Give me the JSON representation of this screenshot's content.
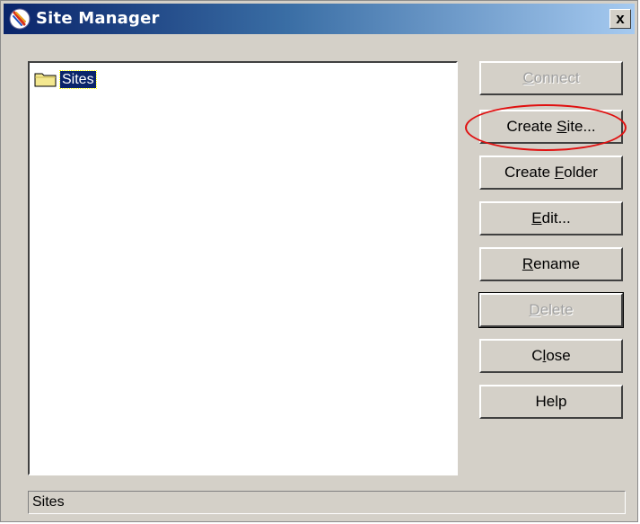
{
  "window": {
    "title": "Site Manager",
    "close_label": "x"
  },
  "tree": {
    "items": [
      {
        "label": "Sites",
        "icon": "folder-icon",
        "selected": true
      }
    ]
  },
  "buttons": [
    {
      "label": "Connect",
      "mnemonic": "C",
      "rest": "onnect",
      "disabled": true
    },
    {
      "label": "Create Site...",
      "prefix": "Create ",
      "mnemonic": "S",
      "rest": "ite...",
      "disabled": false,
      "highlighted": true
    },
    {
      "label": "Create Folder",
      "prefix": "Create ",
      "mnemonic": "F",
      "rest": "older",
      "disabled": false
    },
    {
      "label": "Edit...",
      "mnemonic": "E",
      "rest": "dit...",
      "disabled": false
    },
    {
      "label": "Rename",
      "mnemonic": "R",
      "rest": "ename",
      "disabled": false
    },
    {
      "label": "Delete",
      "mnemonic": "D",
      "rest": "elete",
      "disabled": true
    },
    {
      "label": "Close",
      "prefix": "C",
      "mnemonic": "l",
      "rest": "ose",
      "disabled": false
    },
    {
      "label": "Help",
      "disabled": false
    }
  ],
  "status_bar": {
    "text": "Sites"
  },
  "colors": {
    "title_gradient_start": "#0a246a",
    "title_gradient_end": "#a6caf0",
    "highlight": "#e01010",
    "selection": "#0a246a"
  }
}
